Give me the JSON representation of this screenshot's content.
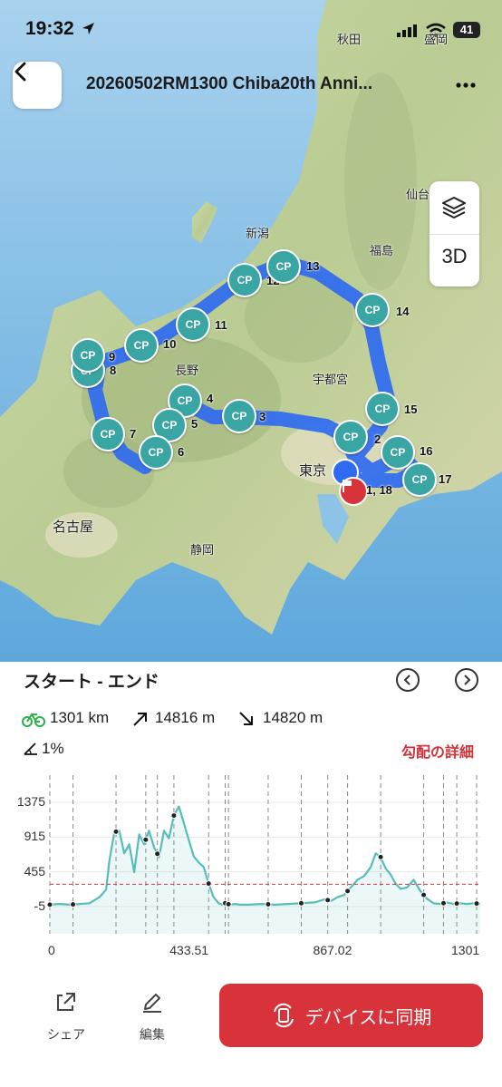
{
  "status": {
    "time": "19:32",
    "battery": "41"
  },
  "header": {
    "title": "20260502RM1300 Chiba20th Anni..."
  },
  "map_controls": {
    "layers_icon": "layers-icon",
    "mode_3d": "3D"
  },
  "cities": {
    "akita": "秋田",
    "morioka": "盛岡",
    "sendai": "仙台",
    "niigata": "新潟",
    "fukushima": "福島",
    "nagano": "長野",
    "utsunomiya": "宇都宮",
    "tokyo": "東京",
    "nagoya": "名古屋",
    "shizuoka": "静岡"
  },
  "checkpoints": [
    {
      "cp": "CP",
      "num": "1, 18"
    },
    {
      "cp": "CP",
      "num": "2"
    },
    {
      "cp": "CP",
      "num": "3"
    },
    {
      "cp": "CP",
      "num": "4"
    },
    {
      "cp": "CP",
      "num": "5"
    },
    {
      "cp": "CP",
      "num": "6"
    },
    {
      "cp": "CP",
      "num": "7"
    },
    {
      "cp": "CP",
      "num": "8"
    },
    {
      "cp": "CP",
      "num": "9"
    },
    {
      "cp": "CP",
      "num": "10"
    },
    {
      "cp": "CP",
      "num": "11"
    },
    {
      "cp": "CP",
      "num": "12"
    },
    {
      "cp": "CP",
      "num": "13"
    },
    {
      "cp": "CP",
      "num": "14"
    },
    {
      "cp": "CP",
      "num": "15"
    },
    {
      "cp": "CP",
      "num": "16"
    },
    {
      "cp": "CP",
      "num": "17"
    }
  ],
  "panel": {
    "range_label": "スタート  - エンド",
    "distance": "1301 km",
    "ascent": "14816 m",
    "descent": "14820 m",
    "grade": "1%",
    "grade_detail": "勾配の詳細"
  },
  "chart_data": {
    "type": "area",
    "title": "",
    "xlabel": "",
    "ylabel": "",
    "y_ticks": [
      "1375",
      "915",
      "455",
      "-5"
    ],
    "x_ticks": [
      "0",
      "433.51",
      "867.02",
      "1301"
    ],
    "xlim": [
      0,
      1301
    ],
    "ylim": [
      -5,
      1375
    ],
    "average_line": 290,
    "series": [
      {
        "x": [
          0,
          30,
          60,
          90,
          120,
          150,
          170,
          180,
          195,
          210,
          225,
          240,
          255,
          270,
          285,
          300,
          315,
          330,
          345,
          360,
          375,
          390,
          405,
          420,
          435,
          450,
          465,
          480,
          495,
          510,
          520,
          530,
          545,
          560,
          575,
          600,
          640,
          680,
          720,
          760,
          800,
          830,
          850,
          870,
          890,
          910,
          930,
          950,
          970,
          985,
          1000,
          1015,
          1030,
          1045,
          1060,
          1080,
          1100,
          1120,
          1140,
          1160,
          1180,
          1200,
          1220,
          1240,
          1260,
          1280,
          1301
        ],
        "y": [
          20,
          30,
          20,
          30,
          40,
          120,
          220,
          600,
          980,
          1000,
          700,
          820,
          450,
          950,
          820,
          1000,
          780,
          650,
          1000,
          900,
          1200,
          1320,
          1100,
          880,
          660,
          580,
          520,
          300,
          120,
          40,
          20,
          40,
          20,
          30,
          20,
          20,
          30,
          20,
          30,
          40,
          50,
          90,
          70,
          120,
          150,
          250,
          350,
          400,
          520,
          700,
          650,
          500,
          420,
          300,
          230,
          250,
          350,
          200,
          100,
          40,
          30,
          50,
          30,
          40,
          30,
          40,
          30
        ]
      }
    ],
    "markers_x": [
      0,
      70,
      200,
      290,
      325,
      375,
      480,
      530,
      540,
      660,
      760,
      840,
      900,
      1000,
      1130,
      1190,
      1230,
      1290
    ]
  },
  "footer": {
    "share_label": "シェア",
    "edit_label": "編集",
    "sync_label": "デバイスに同期"
  }
}
